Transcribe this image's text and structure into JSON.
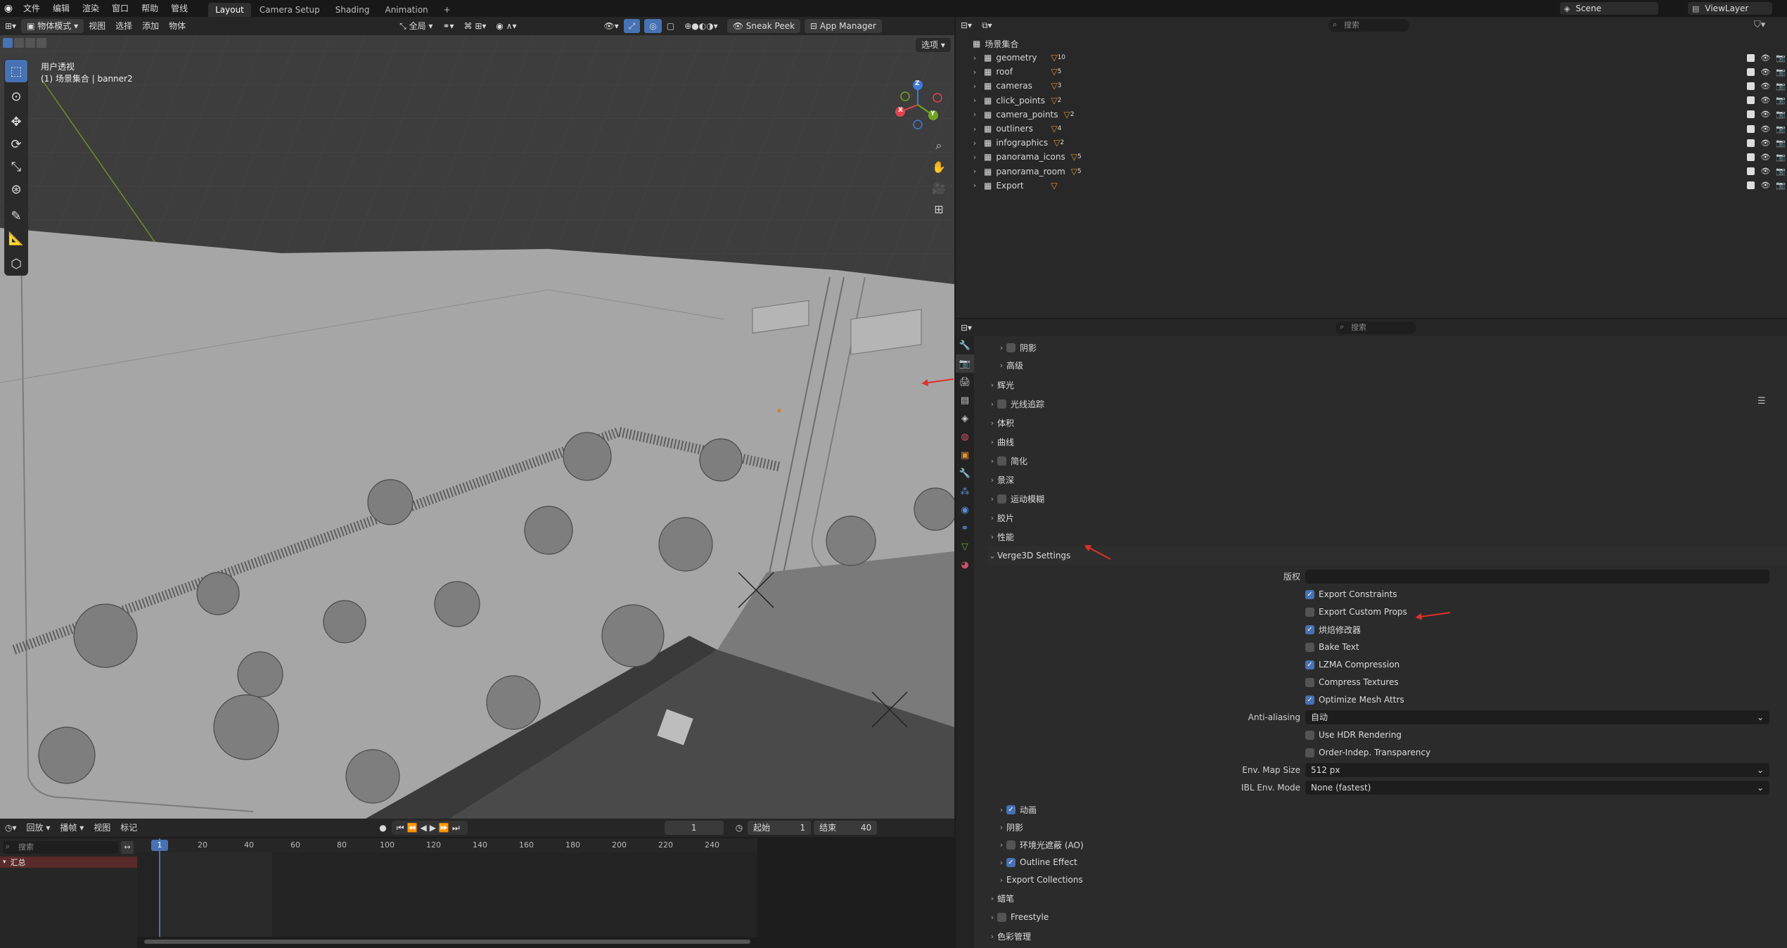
{
  "topbar": {
    "menus": [
      "文件",
      "编辑",
      "渲染",
      "窗口",
      "帮助",
      "管线"
    ],
    "workspace_tabs": [
      "Layout",
      "Camera Setup",
      "Shading",
      "Animation"
    ],
    "add_tab": "+",
    "scene": "Scene",
    "view_layer": "ViewLayer"
  },
  "viewport": {
    "mode": "物体模式",
    "menus": [
      "视图",
      "选择",
      "添加",
      "物体"
    ],
    "transform_orientation": "全局",
    "sneak_peek": "Sneak Peek",
    "app_manager": "App Manager",
    "options": "选项",
    "overlay_title": "用户透视",
    "overlay_subtitle": "(1) 场景集合 | banner2",
    "gizmo": {
      "x": "X",
      "y": "Y",
      "z": "Z"
    },
    "colors": {
      "x_axis": "#e0444e",
      "y_axis": "#6fa51d",
      "z_axis": "#3d7bd9",
      "accent": "#4772b3"
    }
  },
  "timeline": {
    "menus": [
      "回放",
      "播帧",
      "视图",
      "标记"
    ],
    "current_frame": "1",
    "start_label": "起始",
    "start_value": "1",
    "end_label": "结束",
    "end_value": "40",
    "search_placeholder": "搜索",
    "channel": "汇总",
    "ruler": [
      "1",
      "20",
      "40",
      "60",
      "80",
      "100",
      "120",
      "140",
      "160",
      "180",
      "200",
      "220",
      "240"
    ]
  },
  "outliner": {
    "search_placeholder": "搜索",
    "root": "场景集合",
    "items": [
      {
        "name": "geometry",
        "badge": "10"
      },
      {
        "name": "roof",
        "badge": "5"
      },
      {
        "name": "cameras",
        "badge": "3"
      },
      {
        "name": "click_points",
        "badge": "2"
      },
      {
        "name": "camera_points",
        "badge": "2"
      },
      {
        "name": "outliners",
        "badge": "4"
      },
      {
        "name": "infographics",
        "badge": "2"
      },
      {
        "name": "panorama_icons",
        "badge": "5"
      },
      {
        "name": "panorama_room",
        "badge": "5"
      },
      {
        "name": "Export",
        "badge": ""
      }
    ]
  },
  "properties": {
    "search_placeholder": "搜索",
    "top_subpanels": [
      "阴影",
      "高级"
    ],
    "panels": [
      "辉光",
      "光线追踪",
      "体积",
      "曲线",
      "简化",
      "景深",
      "运动模糊",
      "胶片",
      "性能"
    ],
    "verge": {
      "title": "Verge3D Settings",
      "copyright_label": "版权",
      "copyright_value": "",
      "options": [
        {
          "label": "Export Constraints",
          "checked": true
        },
        {
          "label": "Export Custom Props",
          "checked": false
        },
        {
          "label": "烘焙修改器",
          "checked": true
        },
        {
          "label": "Bake Text",
          "checked": false
        },
        {
          "label": "LZMA Compression",
          "checked": true
        },
        {
          "label": "Compress Textures",
          "checked": false
        },
        {
          "label": "Optimize Mesh Attrs",
          "checked": true
        }
      ],
      "anti_aliasing_label": "Anti-aliasing",
      "anti_aliasing_value": "自动",
      "options2": [
        {
          "label": "Use HDR Rendering",
          "checked": false
        },
        {
          "label": "Order-Indep. Transparency",
          "checked": false
        }
      ],
      "env_map_label": "Env. Map Size",
      "env_map_value": "512 px",
      "ibl_label": "IBL Env. Mode",
      "ibl_value": "None (fastest)",
      "subpanels": [
        "动画",
        "阴影",
        "环境光遮蔽 (AO)",
        "Outline Effect",
        "Export Collections"
      ]
    },
    "bottom_panels": [
      "蜡笔",
      "Freestyle",
      "色彩管理"
    ]
  }
}
